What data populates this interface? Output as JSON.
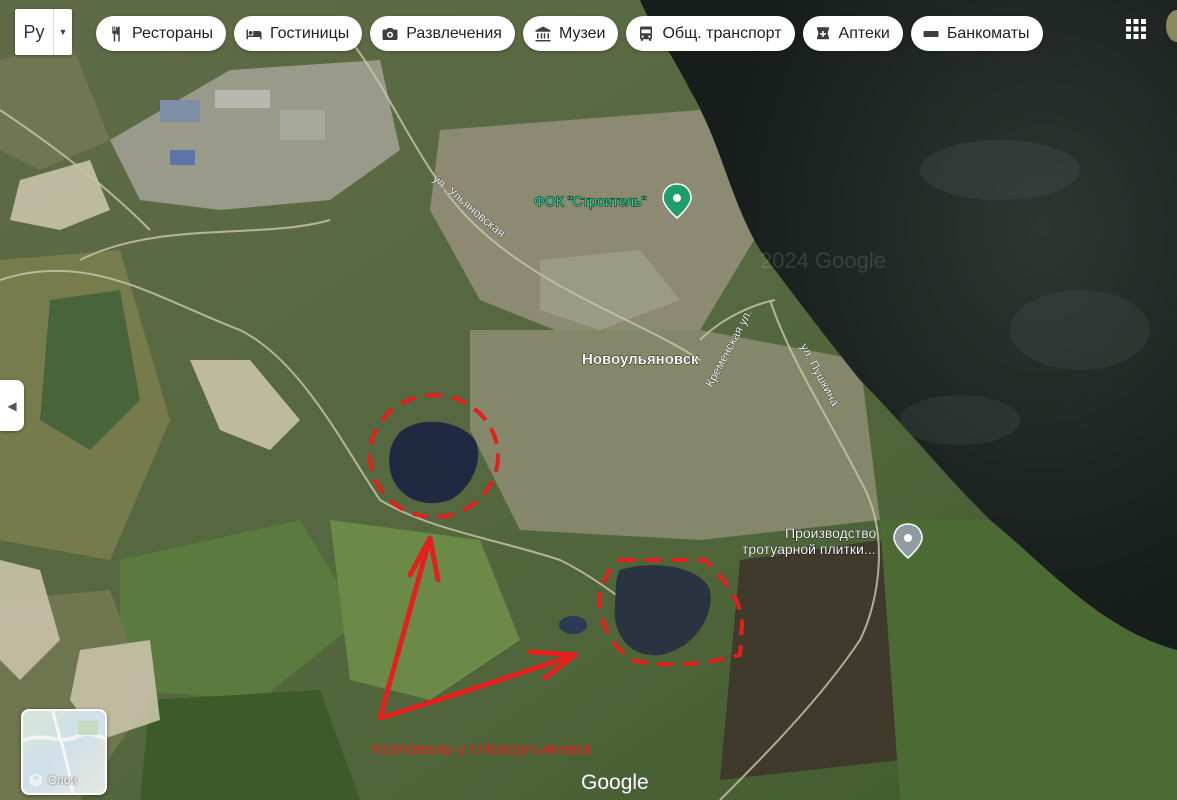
{
  "lang_switch": {
    "label": "Ру"
  },
  "categories": [
    {
      "label": "Рестораны",
      "icon": "fork-knife-icon"
    },
    {
      "label": "Гостиницы",
      "icon": "bed-icon"
    },
    {
      "label": "Развлечения",
      "icon": "camera-icon"
    },
    {
      "label": "Музеи",
      "icon": "museum-icon"
    },
    {
      "label": "Общ. транспорт",
      "icon": "bus-icon"
    },
    {
      "label": "Аптеки",
      "icon": "pharmacy-icon"
    },
    {
      "label": "Банкоматы",
      "icon": "atm-icon"
    }
  ],
  "map": {
    "place_fok": "ФОК \"Строитель\"",
    "city": "Новоульяновск",
    "street_ulyanovskaya": "ул. Ульяновская",
    "street_kremenskaya": "Кременская ул.",
    "street_pushkina": "ул. Пушкина",
    "place_tiles_line1": "Производство",
    "place_tiles_line2": "тротуарной плитки...",
    "watermark": "2024 Google",
    "annotation": "Котлованы у г.Новоульяновск",
    "google_logo": "Google",
    "annotation_color": "#e3201b",
    "pin_green": "#1e9e6a",
    "pin_gray": "#8f9aa3"
  },
  "layers": {
    "label": "Слои"
  }
}
